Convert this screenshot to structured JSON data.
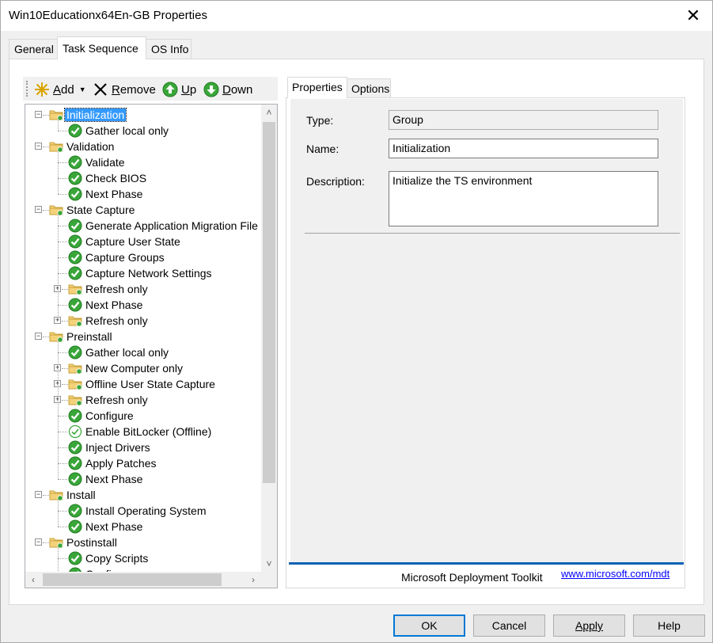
{
  "window": {
    "title": "Win10Educationx64En-GB Properties",
    "close": "✕"
  },
  "tabs": [
    {
      "label": "General"
    },
    {
      "label": "Task Sequence"
    },
    {
      "label": "OS Info"
    }
  ],
  "toolbar": {
    "add": {
      "label": "Add",
      "hotkey": "A",
      "rest": "dd"
    },
    "remove": {
      "label": "Remove",
      "hotkey": "R",
      "rest": "emove"
    },
    "up": {
      "label": "Up",
      "hotkey": "U",
      "rest": "p"
    },
    "down": {
      "label": "Down",
      "hotkey": "D",
      "rest": "own"
    }
  },
  "tree": {
    "items": [
      {
        "label": "Initialization",
        "type": "group",
        "level": 0,
        "expanded": true,
        "selected": true
      },
      {
        "label": "Gather local only",
        "type": "step",
        "level": 1
      },
      {
        "label": "Validation",
        "type": "group",
        "level": 0,
        "expanded": true
      },
      {
        "label": "Validate",
        "type": "step",
        "level": 1
      },
      {
        "label": "Check BIOS",
        "type": "step",
        "level": 1
      },
      {
        "label": "Next Phase",
        "type": "step",
        "level": 1
      },
      {
        "label": "State Capture",
        "type": "group",
        "level": 0,
        "expanded": true
      },
      {
        "label": "Generate Application Migration File",
        "type": "step",
        "level": 1
      },
      {
        "label": "Capture User State",
        "type": "step",
        "level": 1
      },
      {
        "label": "Capture Groups",
        "type": "step",
        "level": 1
      },
      {
        "label": "Capture Network Settings",
        "type": "step",
        "level": 1
      },
      {
        "label": "Refresh only",
        "type": "group",
        "level": 1,
        "expanded": false
      },
      {
        "label": "Next Phase",
        "type": "step",
        "level": 1
      },
      {
        "label": "Refresh only",
        "type": "group",
        "level": 1,
        "expanded": false
      },
      {
        "label": "Preinstall",
        "type": "group",
        "level": 0,
        "expanded": true
      },
      {
        "label": "Gather local only",
        "type": "step",
        "level": 1
      },
      {
        "label": "New Computer only",
        "type": "group",
        "level": 1,
        "expanded": false
      },
      {
        "label": "Offline User State Capture",
        "type": "group",
        "level": 1,
        "expanded": false
      },
      {
        "label": "Refresh only",
        "type": "group",
        "level": 1,
        "expanded": false
      },
      {
        "label": "Configure",
        "type": "step",
        "level": 1
      },
      {
        "label": "Enable BitLocker (Offline)",
        "type": "step-disabled",
        "level": 1
      },
      {
        "label": "Inject Drivers",
        "type": "step",
        "level": 1
      },
      {
        "label": "Apply Patches",
        "type": "step",
        "level": 1
      },
      {
        "label": "Next Phase",
        "type": "step",
        "level": 1
      },
      {
        "label": "Install",
        "type": "group",
        "level": 0,
        "expanded": true
      },
      {
        "label": "Install Operating System",
        "type": "step",
        "level": 1
      },
      {
        "label": "Next Phase",
        "type": "step",
        "level": 1
      },
      {
        "label": "Postinstall",
        "type": "group",
        "level": 0,
        "expanded": true
      },
      {
        "label": "Copy Scripts",
        "type": "step",
        "level": 1
      },
      {
        "label": "Configure",
        "type": "step",
        "level": 1
      }
    ]
  },
  "right_tabs": [
    {
      "label": "Properties"
    },
    {
      "label": "Options"
    }
  ],
  "properties": {
    "type_label": "Type:",
    "type_value": "Group",
    "name_label": "Name:",
    "name_value": "Initialization",
    "description_label": "Description:",
    "description_value": "Initialize the TS environment"
  },
  "footer": {
    "text": "Microsoft Deployment Toolkit",
    "link": "www.microsoft.com/mdt"
  },
  "buttons": {
    "ok": "OK",
    "cancel": "Cancel",
    "apply": "Apply",
    "help": "Help"
  },
  "colors": {
    "selection": "#3399ff",
    "accent": "#0078d7",
    "footer_bar": "#0b61b5",
    "link": "#0000ff",
    "check_green": "#2e9e2e"
  }
}
